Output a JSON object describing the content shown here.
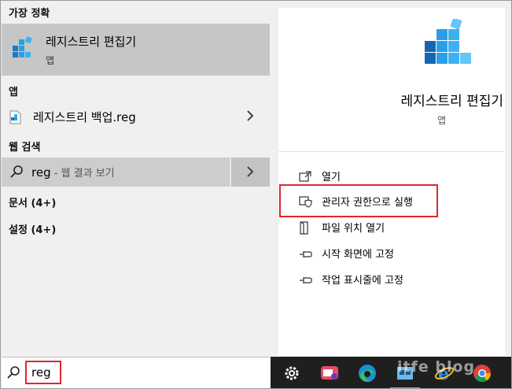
{
  "left": {
    "best_match_header": "가장 정확",
    "best_match": {
      "title": "레지스트리 편집기",
      "subtitle": "앱"
    },
    "apps_header": "앱",
    "apps": [
      {
        "label": "레지스트리 백업.reg"
      }
    ],
    "web_header": "웹 검색",
    "web": {
      "query": "reg",
      "suffix": " - 웹 결과 보기"
    },
    "docs_header": "문서 (4+)",
    "settings_header": "설정 (4+)"
  },
  "right": {
    "title": "레지스트리 편집기",
    "subtitle": "앱",
    "actions": [
      {
        "label": "열기",
        "icon": "open-icon"
      },
      {
        "label": "관리자 권한으로 실행",
        "icon": "shield-icon"
      },
      {
        "label": "파일 위치 열기",
        "icon": "file-location-icon"
      },
      {
        "label": "시작 화면에 고정",
        "icon": "pin-icon"
      },
      {
        "label": "작업 표시줄에 고정",
        "icon": "pin-icon"
      }
    ]
  },
  "search": {
    "value": "reg"
  },
  "taskbar": {
    "icons": [
      "settings-icon",
      "media-icon",
      "edge-icon",
      "app-icon",
      "ie-icon",
      "chrome-icon"
    ]
  },
  "watermark": "itfe blog",
  "colors": {
    "highlight": "#e3262d",
    "selected": "#c6c6c6",
    "taskbar": "#1f1f1f"
  }
}
